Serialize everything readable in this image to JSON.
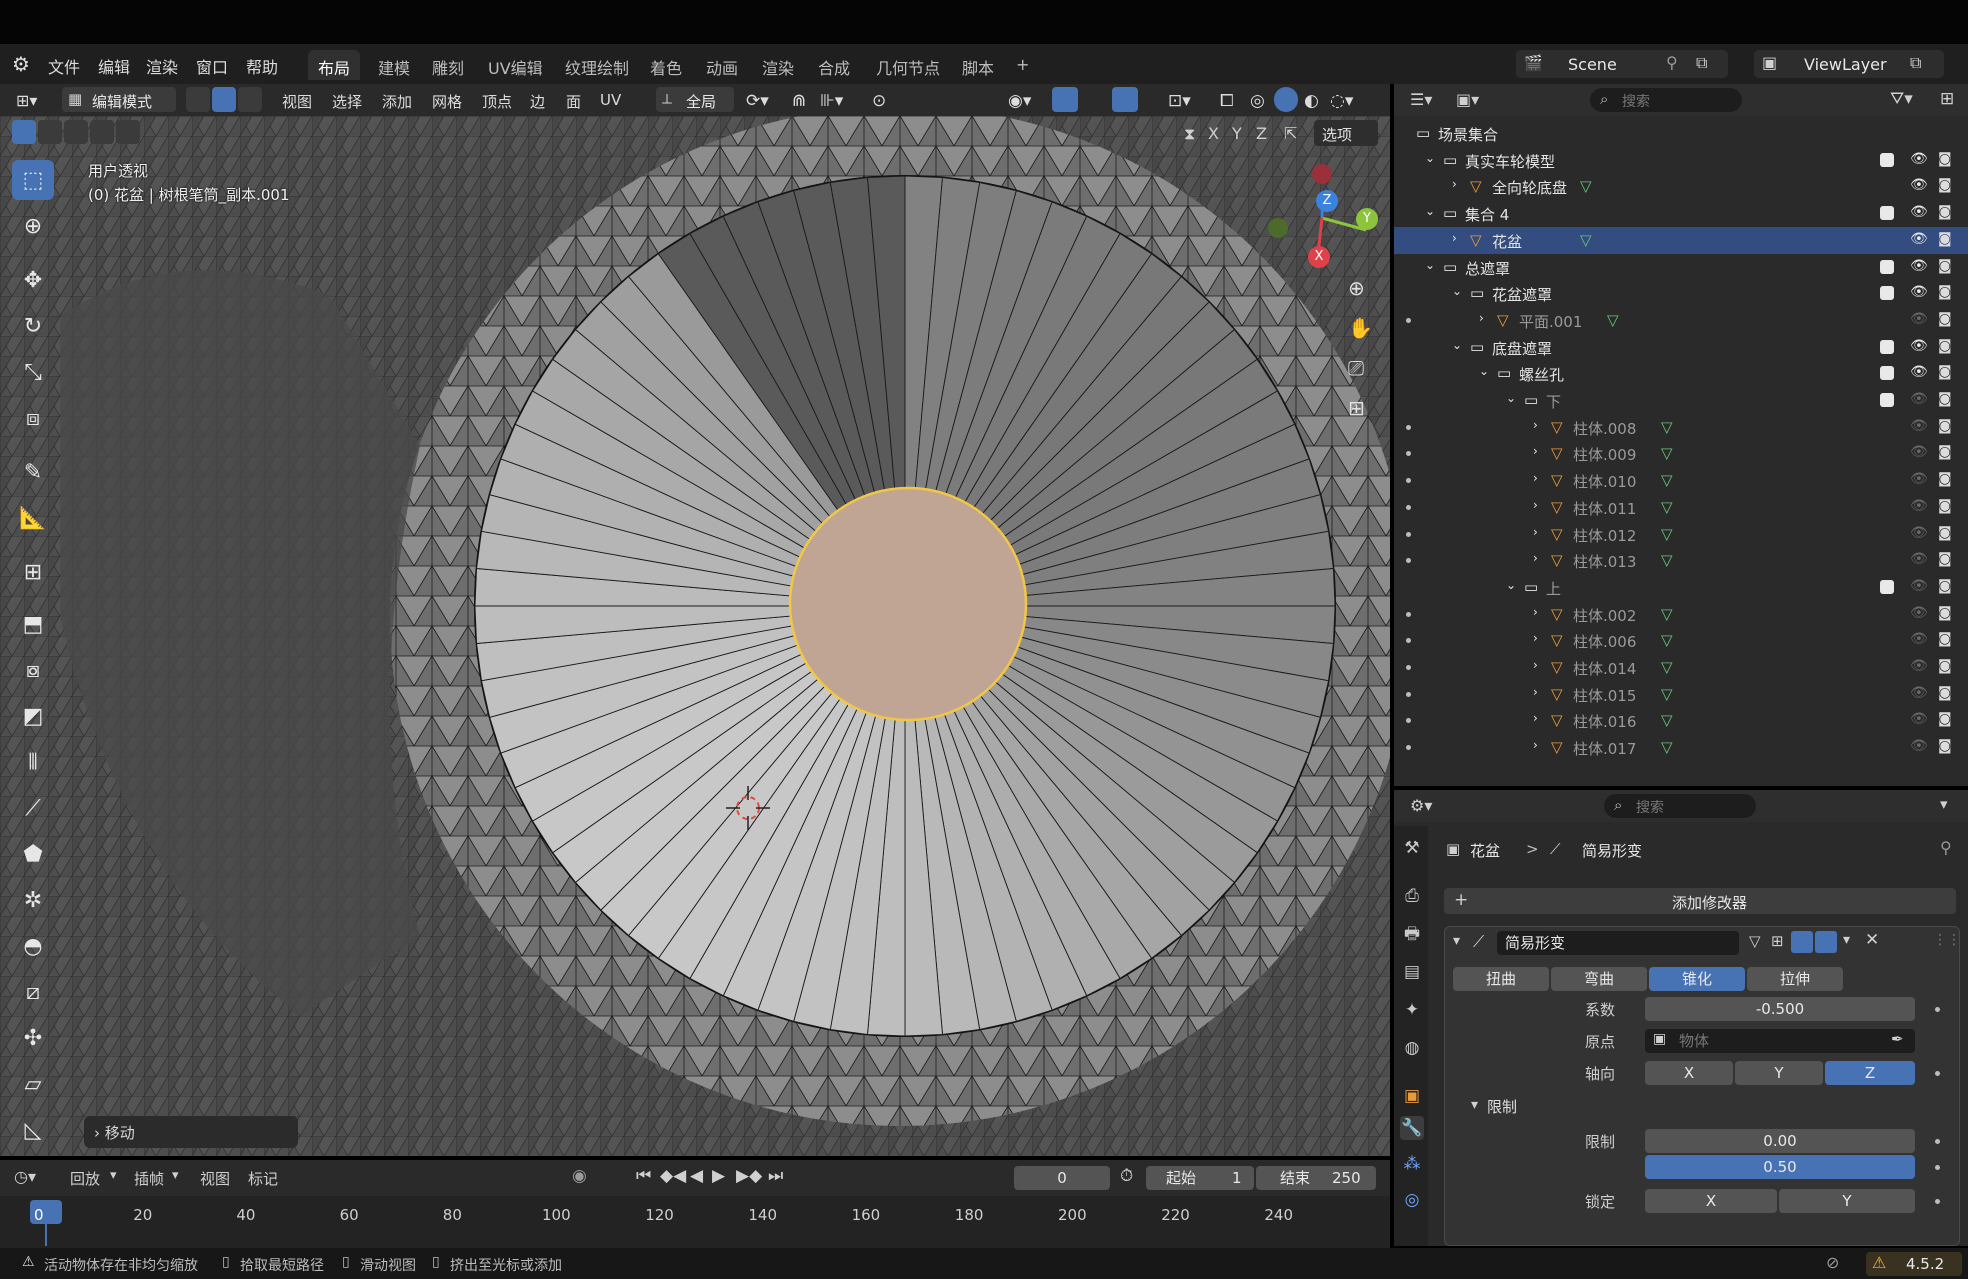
{
  "menu": {
    "items": [
      "文件",
      "编辑",
      "渲染",
      "窗口",
      "帮助"
    ],
    "workspaces": [
      "布局",
      "建模",
      "雕刻",
      "UV编辑",
      "纹理绘制",
      "着色",
      "动画",
      "渲染",
      "合成",
      "几何节点",
      "脚本"
    ],
    "active_workspace": "布局",
    "add_tab": "+",
    "scene": "Scene",
    "view_layer": "ViewLayer"
  },
  "viewport_header": {
    "mode": "编辑模式",
    "menus": [
      "视图",
      "选择",
      "添加",
      "网格",
      "顶点",
      "边",
      "面",
      "UV"
    ],
    "transform_orientation": "全局",
    "axis_x": "X",
    "axis_y": "Y",
    "axis_z": "Z",
    "options": "选项"
  },
  "viewport": {
    "view_name": "用户透视",
    "object_info": "(0) 花盆 | 树根笔筒_副本.001",
    "gizmo_x": "X",
    "gizmo_y": "Y",
    "gizmo_z": "Z",
    "last_operator": "移动"
  },
  "outliner": {
    "search_placeholder": "搜索",
    "rows": [
      {
        "label": "场景集合",
        "depth": 0,
        "kind": "collection"
      },
      {
        "label": "真实车轮模型",
        "depth": 1,
        "kind": "collection",
        "check": true
      },
      {
        "label": "全向轮底盘",
        "depth": 2,
        "kind": "mesh",
        "check": false
      },
      {
        "label": "集合 4",
        "depth": 1,
        "kind": "collection",
        "check": true
      },
      {
        "label": "花盆",
        "depth": 2,
        "kind": "mesh",
        "selected": true
      },
      {
        "label": "总遮罩",
        "depth": 1,
        "kind": "collection",
        "check": true
      },
      {
        "label": "花盆遮罩",
        "depth": 2,
        "kind": "collection",
        "check": true
      },
      {
        "label": "平面.001",
        "depth": 3,
        "kind": "mesh",
        "dim": true
      },
      {
        "label": "底盘遮罩",
        "depth": 2,
        "kind": "collection",
        "check": true
      },
      {
        "label": "螺丝孔",
        "depth": 3,
        "kind": "collection",
        "check": true
      },
      {
        "label": "下",
        "depth": 4,
        "kind": "collection",
        "check": true,
        "dim": true
      },
      {
        "label": "柱体.008",
        "depth": 5,
        "kind": "mesh",
        "dim": true
      },
      {
        "label": "柱体.009",
        "depth": 5,
        "kind": "mesh",
        "dim": true
      },
      {
        "label": "柱体.010",
        "depth": 5,
        "kind": "mesh",
        "dim": true
      },
      {
        "label": "柱体.011",
        "depth": 5,
        "kind": "mesh",
        "dim": true
      },
      {
        "label": "柱体.012",
        "depth": 5,
        "kind": "mesh",
        "dim": true
      },
      {
        "label": "柱体.013",
        "depth": 5,
        "kind": "mesh",
        "dim": true
      },
      {
        "label": "上",
        "depth": 4,
        "kind": "collection",
        "check": true,
        "dim": true
      },
      {
        "label": "柱体.002",
        "depth": 5,
        "kind": "mesh",
        "dim": true
      },
      {
        "label": "柱体.006",
        "depth": 5,
        "kind": "mesh",
        "dim": true
      },
      {
        "label": "柱体.014",
        "depth": 5,
        "kind": "mesh",
        "dim": true
      },
      {
        "label": "柱体.015",
        "depth": 5,
        "kind": "mesh",
        "dim": true
      },
      {
        "label": "柱体.016",
        "depth": 5,
        "kind": "mesh",
        "dim": true
      },
      {
        "label": "柱体.017",
        "depth": 5,
        "kind": "mesh",
        "dim": true
      }
    ]
  },
  "properties": {
    "search_placeholder": "搜索",
    "breadcrumb_object": "花盆",
    "breadcrumb_sep": ">",
    "breadcrumb_modifier": "简易形变",
    "add_modifier": "添加修改器",
    "modifier_name": "简易形变",
    "deform_modes": [
      "扭曲",
      "弯曲",
      "锥化",
      "拉伸"
    ],
    "active_mode": "锥化",
    "factor_label": "系数",
    "factor_value": "-0.500",
    "origin_label": "原点",
    "origin_placeholder": "物体",
    "axis_label": "轴向",
    "axes": [
      "X",
      "Y",
      "Z"
    ],
    "active_axis": "Z",
    "limits_section": "限制",
    "limits_label": "限制",
    "limit_min": "0.00",
    "limit_max": "0.50",
    "lock_label": "锁定",
    "lock_axes": [
      "X",
      "Y"
    ]
  },
  "timeline": {
    "playback": "回放",
    "keying": "插帧",
    "view": "视图",
    "marker": "标记",
    "current_frame": "0",
    "start_label": "起始",
    "start_value": "1",
    "end_label": "结束",
    "end_value": "250",
    "ticks": [
      "0",
      "20",
      "40",
      "60",
      "80",
      "100",
      "120",
      "140",
      "160",
      "180",
      "200",
      "220",
      "240"
    ]
  },
  "status": {
    "warning": "活动物体存在非均匀缩放",
    "hint1": "拾取最短路径",
    "hint2": "滑动视图",
    "hint3": "挤出至光标或添加",
    "version": "4.5.2"
  },
  "colors": {
    "accent": "#4772b3",
    "selected_face": "#c0a594",
    "select_outline": "#f2c744",
    "mesh_orange": "#e89b3a"
  }
}
